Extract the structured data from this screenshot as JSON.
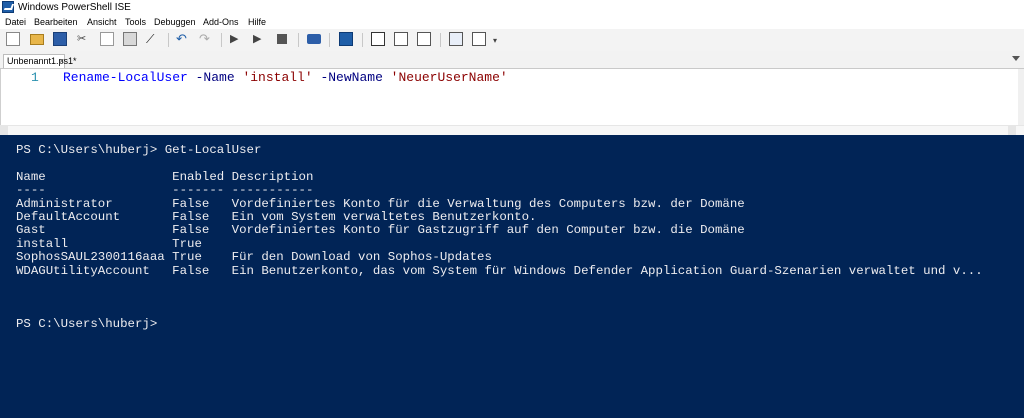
{
  "window": {
    "title": "Windows PowerShell ISE"
  },
  "menu": [
    "Datei",
    "Bearbeiten",
    "Ansicht",
    "Tools",
    "Debuggen",
    "Add-Ons",
    "Hilfe"
  ],
  "toolbar": {
    "buttons": [
      "new-file",
      "open",
      "save",
      "cut",
      "copy",
      "paste",
      "clear",
      "undo",
      "redo",
      "run",
      "run-selection",
      "stop",
      "remote",
      "powershell",
      "layout-top",
      "layout-right",
      "layout-max",
      "show-commands",
      "show-addons"
    ]
  },
  "tabs": [
    {
      "label": "Unbenannt1.ps1*",
      "close": "×"
    }
  ],
  "editor": {
    "line_number": "1",
    "code": {
      "cmd": "Rename-LocalUser",
      "p1": " -Name ",
      "s1": "'install'",
      "p2": " -NewName ",
      "s2": "'NeuerUserName'"
    }
  },
  "console": {
    "prompt1": "PS C:\\Users\\huberj> Get-LocalUser",
    "headers": {
      "name": "Name",
      "enabled": "Enabled",
      "description": "Description"
    },
    "underline": {
      "name": "----",
      "enabled": "-------",
      "description": "-----------"
    },
    "rows": [
      {
        "name": "Administrator",
        "enabled": "False",
        "description": "Vordefiniertes Konto für die Verwaltung des Computers bzw. der Domäne"
      },
      {
        "name": "DefaultAccount",
        "enabled": "False",
        "description": "Ein vom System verwaltetes Benutzerkonto."
      },
      {
        "name": "Gast",
        "enabled": "False",
        "description": "Vordefiniertes Konto für Gastzugriff auf den Computer bzw. die Domäne"
      },
      {
        "name": "install",
        "enabled": "True",
        "description": ""
      },
      {
        "name": "SophosSAUL2300116aaa",
        "enabled": "True",
        "description": "Für den Download von Sophos-Updates"
      },
      {
        "name": "WDAGUtilityAccount",
        "enabled": "False",
        "description": "Ein Benutzerkonto, das vom System für Windows Defender Application Guard-Szenarien verwaltet und v..."
      }
    ],
    "prompt2": "PS C:\\Users\\huberj>"
  },
  "colors": {
    "console_bg": "#012456",
    "console_fg": "#eeedf0",
    "cmdlet": "#0000ff",
    "parameter": "#000080",
    "string": "#8b0000"
  }
}
